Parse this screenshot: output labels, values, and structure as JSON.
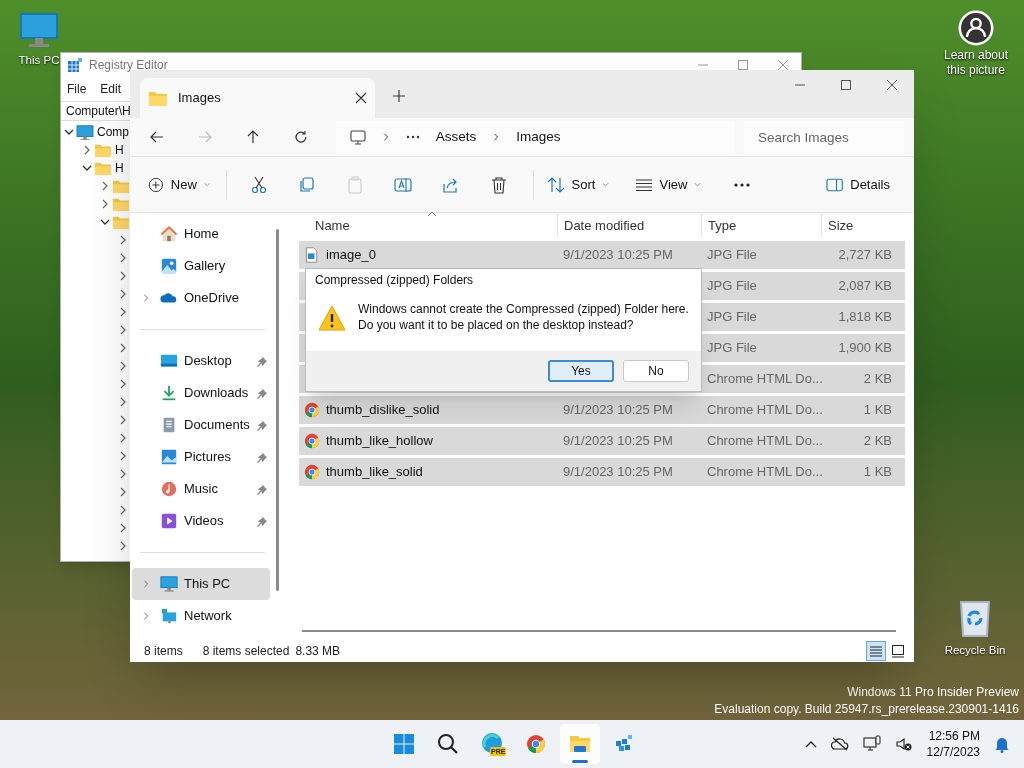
{
  "desktop": {
    "icons": [
      {
        "kind": "this_pc",
        "label": "This PC"
      },
      {
        "kind": "recycle_bin",
        "label": "Recycle Bin"
      }
    ],
    "learn_about": "Learn about this picture",
    "watermark": [
      "Windows 11 Pro Insider Preview",
      "Evaluation copy. Build 25947.rs_prerelease.230901-1416"
    ]
  },
  "registry_editor": {
    "title": "Registry Editor",
    "menu": [
      "File",
      "Edit"
    ],
    "address": "Computer\\H",
    "tree": [
      {
        "label": "Comp",
        "expanded": true,
        "children": [
          {
            "label": "H",
            "expanded": false
          },
          {
            "label": "H",
            "expanded": true,
            "children": [
              {
                "expanded": false
              },
              {
                "expanded": false
              },
              {
                "expanded": true,
                "children": [
                  {
                    "expanded": false
                  },
                  {
                    "expanded": false
                  },
                  {
                    "expanded": false
                  },
                  {
                    "expanded": false
                  },
                  {
                    "expanded": false
                  },
                  {
                    "expanded": false
                  },
                  {
                    "expanded": false
                  },
                  {
                    "expanded": false
                  },
                  {
                    "expanded": false
                  },
                  {
                    "expanded": false
                  },
                  {
                    "expanded": false
                  },
                  {
                    "expanded": false
                  },
                  {
                    "expanded": false
                  },
                  {
                    "expanded": false
                  },
                  {
                    "expanded": false
                  },
                  {
                    "expanded": false
                  },
                  {
                    "expanded": false
                  },
                  {
                    "expanded": false
                  }
                ]
              }
            ]
          }
        ]
      }
    ]
  },
  "explorer": {
    "tabs": [
      {
        "label": "Images",
        "selected": true
      }
    ],
    "breadcrumb": [
      "Assets",
      "Images"
    ],
    "search": {
      "placeholder": "Search Images"
    },
    "toolbar": [
      {
        "kind": "new",
        "label": "New",
        "disabled": false
      },
      {
        "kind": "cut",
        "disabled": false
      },
      {
        "kind": "copy",
        "disabled": false
      },
      {
        "kind": "paste",
        "disabled": true
      },
      {
        "kind": "rename",
        "disabled": false
      },
      {
        "kind": "share",
        "disabled": false
      },
      {
        "kind": "delete",
        "disabled": false
      },
      {
        "kind": "sort",
        "label": "Sort",
        "disabled": false
      },
      {
        "kind": "view",
        "label": "View",
        "disabled": false
      },
      {
        "kind": "more",
        "disabled": false
      },
      {
        "kind": "details",
        "label": "Details",
        "disabled": false
      }
    ],
    "sidebar": [
      {
        "items": [
          {
            "kind": "home",
            "label": "Home",
            "pinned": false,
            "selected": false
          },
          {
            "kind": "gallery",
            "label": "Gallery",
            "pinned": false,
            "selected": false
          },
          {
            "kind": "onedrive",
            "label": "OneDrive",
            "pinned": false,
            "selected": false,
            "expanded": false
          }
        ]
      },
      {
        "items": [
          {
            "kind": "desktop",
            "label": "Desktop",
            "pinned": true,
            "selected": false
          },
          {
            "kind": "downloads",
            "label": "Downloads",
            "pinned": true,
            "selected": false
          },
          {
            "kind": "documents",
            "label": "Documents",
            "pinned": true,
            "selected": false
          },
          {
            "kind": "pictures",
            "label": "Pictures",
            "pinned": true,
            "selected": false
          },
          {
            "kind": "music",
            "label": "Music",
            "pinned": true,
            "selected": false
          },
          {
            "kind": "videos",
            "label": "Videos",
            "pinned": true,
            "selected": false
          }
        ]
      },
      {
        "items": [
          {
            "kind": "this_pc",
            "label": "This PC",
            "pinned": false,
            "selected": true,
            "expanded": false
          },
          {
            "kind": "network",
            "label": "Network",
            "pinned": false,
            "selected": false,
            "expanded": false
          }
        ]
      }
    ],
    "files": {
      "columns": [
        "Name",
        "Date modified",
        "Type",
        "Size"
      ],
      "rows": [
        {
          "kind": "jpg",
          "name": "image_0",
          "date": "9/1/2023 10:25 PM",
          "type": "JPG File",
          "size": "2,727 KB",
          "selected": true
        },
        {
          "type": "JPG File",
          "size": "2,087 KB",
          "selected": true
        },
        {
          "type": "JPG File",
          "size": "1,818 KB",
          "selected": true
        },
        {
          "type": "JPG File",
          "size": "1,900 KB",
          "selected": true
        },
        {
          "type": "Chrome HTML Do...",
          "size": "2 KB",
          "selected": true
        },
        {
          "kind": "chrome_html",
          "name": "thumb_dislike_solid",
          "date": "9/1/2023 10:25 PM",
          "type": "Chrome HTML Do...",
          "size": "1 KB",
          "selected": true
        },
        {
          "kind": "chrome_html",
          "name": "thumb_like_hollow",
          "date": "9/1/2023 10:25 PM",
          "type": "Chrome HTML Do...",
          "size": "2 KB",
          "selected": true
        },
        {
          "kind": "chrome_html",
          "name": "thumb_like_solid",
          "date": "9/1/2023 10:25 PM",
          "type": "Chrome HTML Do...",
          "size": "1 KB",
          "selected": true
        }
      ]
    },
    "status": [
      "8 items",
      "8 items selected",
      "8.33 MB"
    ],
    "view_buttons": [
      {
        "kind": "details",
        "selected": true
      },
      {
        "kind": "tiles",
        "selected": false
      }
    ]
  },
  "dialog": {
    "title": "Compressed (zipped) Folders",
    "message": [
      "Windows cannot create the Compressed (zipped) Folder here.",
      "Do you want it to be placed on the desktop instead?"
    ],
    "buttons": [
      {
        "label": "Yes",
        "focused": true
      },
      {
        "label": "No",
        "focused": false
      }
    ]
  },
  "taskbar": {
    "apps": [
      {
        "kind": "start",
        "active": false
      },
      {
        "kind": "search",
        "active": false
      },
      {
        "kind": "edge",
        "badge": "PRE",
        "active": false
      },
      {
        "kind": "chrome",
        "active": false
      },
      {
        "kind": "explorer",
        "active": true
      },
      {
        "kind": "registry",
        "active": false
      }
    ],
    "time": "12:56 PM",
    "date": "12/7/2023"
  }
}
